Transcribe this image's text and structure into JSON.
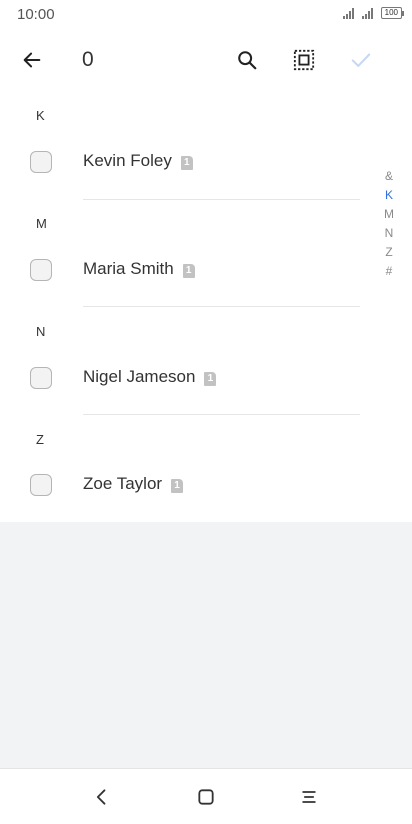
{
  "status_bar": {
    "time": "10:00",
    "battery": "100"
  },
  "app_bar": {
    "selected_count": "0",
    "icons": {
      "back": "arrow-left-icon",
      "search": "search-icon",
      "select_all": "select-all-icon",
      "confirm": "check-icon"
    }
  },
  "contacts": {
    "sections": [
      {
        "header": "K",
        "name": "Kevin Foley",
        "sim": "1"
      },
      {
        "header": "M",
        "name": "Maria Smith",
        "sim": "1"
      },
      {
        "header": "N",
        "name": "Nigel Jameson",
        "sim": "1"
      },
      {
        "header": "Z",
        "name": "Zoe Taylor",
        "sim": "1"
      }
    ]
  },
  "index_bar": {
    "letters": [
      "&",
      "K",
      "M",
      "N",
      "Z",
      "#"
    ],
    "active": "K"
  },
  "nav_bar": {
    "icons": [
      "back-icon",
      "home-icon",
      "menu-icon"
    ]
  },
  "colors": {
    "accent": "#2f6fe0",
    "confirm_disabled": "#c7d7f2",
    "background": "#f2f3f5"
  }
}
